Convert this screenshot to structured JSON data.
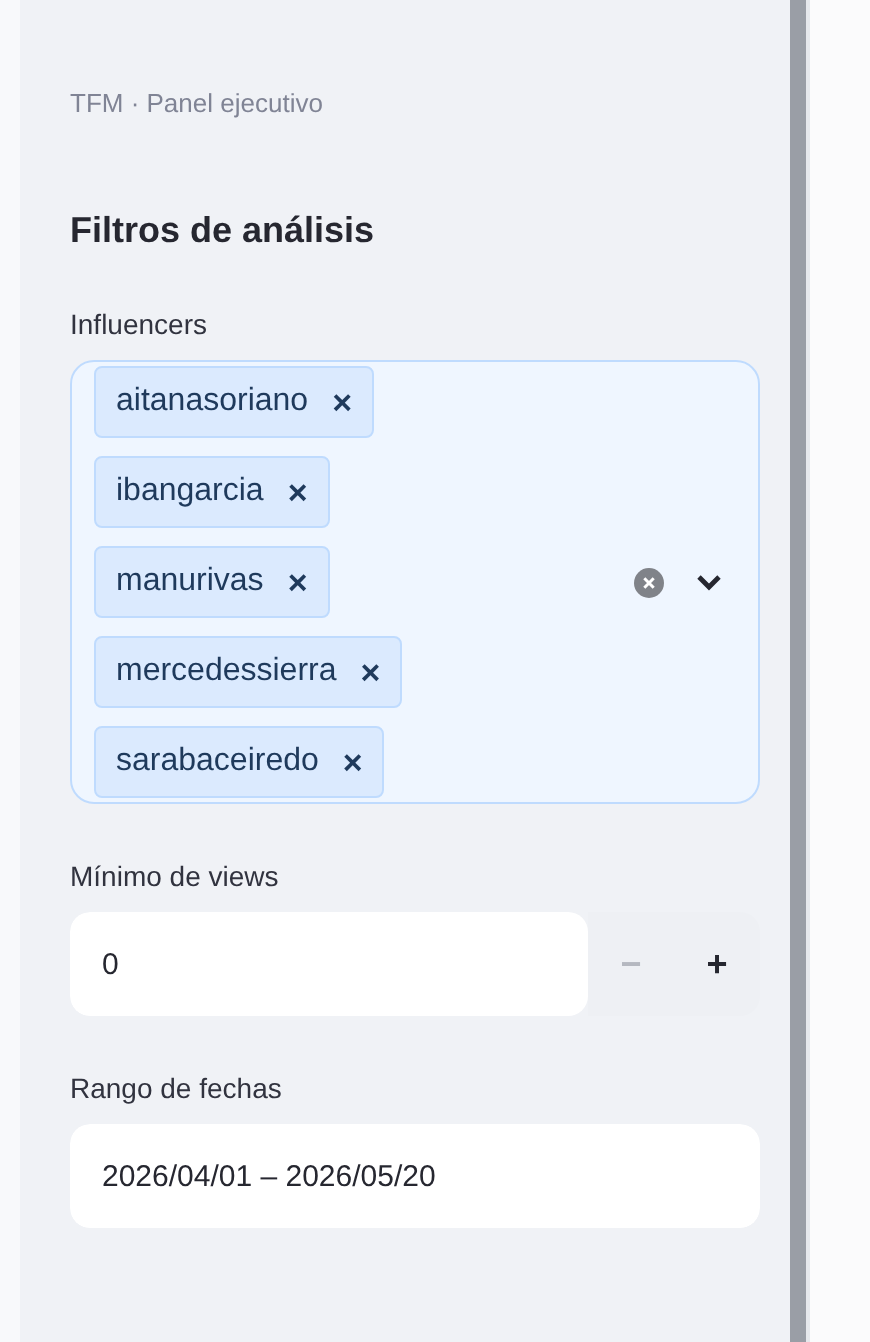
{
  "sidebar": {
    "caption": "TFM · Panel ejecutivo",
    "heading": "Filtros de análisis",
    "influencers": {
      "label": "Influencers",
      "tags": [
        {
          "label": "aitanasoriano",
          "remove": "×"
        },
        {
          "label": "ibangarcia",
          "remove": "×"
        },
        {
          "label": "manurivas",
          "remove": "×"
        },
        {
          "label": "mercedessierra",
          "remove": "×"
        },
        {
          "label": "sarabaceiredo",
          "remove": "×"
        }
      ]
    },
    "min_views": {
      "label": "Mínimo de views",
      "value": "0",
      "steppers": [
        {
          "symbol": "−",
          "disabled": true
        },
        {
          "symbol": "+",
          "disabled": false
        }
      ]
    },
    "date_range": {
      "label": "Rango de fechas",
      "value": "2026/04/01 – 2026/05/20"
    }
  }
}
